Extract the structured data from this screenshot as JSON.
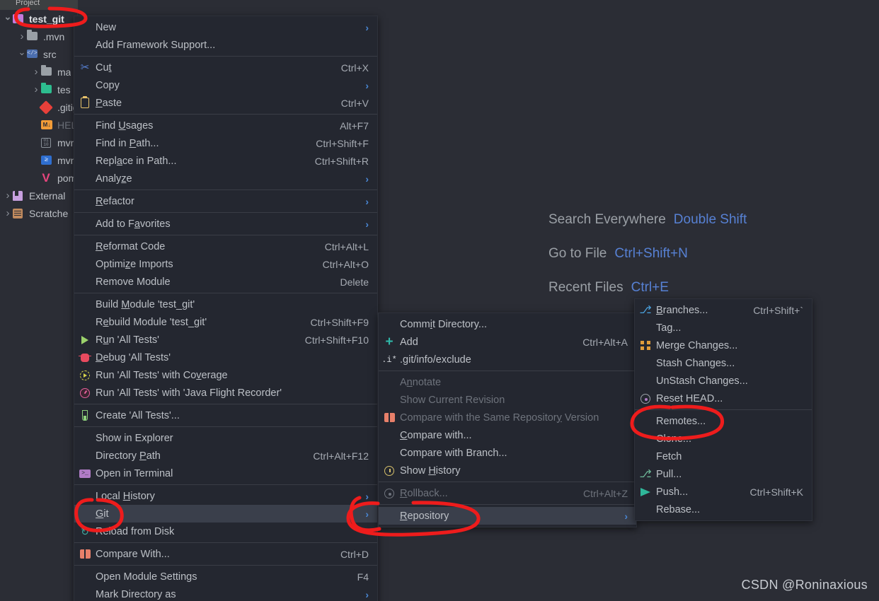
{
  "app": {
    "panel_title": "Project",
    "watermark": "CSDN @Roninaxious",
    "accent_blue": "#5781d4",
    "menu_bg": "#242730",
    "editor_bg": "#2b2d35",
    "annotation_color": "#ee1c1c"
  },
  "sidebar": {
    "items": [
      {
        "label": "test_git",
        "icon": "module-icon",
        "arrow": "down",
        "indent": 0,
        "dim": false,
        "root": true
      },
      {
        "label": ".mvn",
        "icon": "folder-icon",
        "arrow": "right",
        "indent": 1,
        "dim": false,
        "root": false
      },
      {
        "label": "src",
        "icon": "source-folder-icon",
        "arrow": "down",
        "indent": 1,
        "dim": false,
        "root": false
      },
      {
        "label": "ma",
        "icon": "folder-icon",
        "arrow": "right",
        "indent": 2,
        "dim": false,
        "root": false
      },
      {
        "label": "tes",
        "icon": "test-folder-icon",
        "arrow": "right",
        "indent": 2,
        "dim": false,
        "root": false
      },
      {
        "label": ".gitigr",
        "icon": "git-file-icon",
        "arrow": "blank",
        "indent": 2,
        "dim": false,
        "root": false
      },
      {
        "label": "HELP.",
        "icon": "markdown-icon",
        "arrow": "blank",
        "indent": 2,
        "dim": true,
        "root": false
      },
      {
        "label": "mvnw",
        "icon": "binary-file-icon",
        "arrow": "blank",
        "indent": 2,
        "dim": false,
        "root": false
      },
      {
        "label": "mvnw",
        "icon": "powershell-icon",
        "arrow": "blank",
        "indent": 2,
        "dim": false,
        "root": false
      },
      {
        "label": "pom.x",
        "icon": "maven-icon",
        "arrow": "blank",
        "indent": 2,
        "dim": false,
        "root": false
      },
      {
        "label": "External",
        "icon": "external-libs-icon",
        "arrow": "right",
        "indent": 0,
        "dim": false,
        "root": false
      },
      {
        "label": "Scratche",
        "icon": "scratches-icon",
        "arrow": "right",
        "indent": 0,
        "dim": false,
        "root": false
      }
    ]
  },
  "editor_hints": [
    {
      "label": "Search Everywhere",
      "key": "Double Shift"
    },
    {
      "label": "Go to File",
      "key": "Ctrl+Shift+N"
    },
    {
      "label": "Recent Files",
      "key": "Ctrl+E"
    }
  ],
  "context_menu": {
    "groups": [
      [
        {
          "label": "New",
          "accel": "",
          "icon": "",
          "shortcut": "",
          "submenu": true,
          "selected": false,
          "disabled": false
        },
        {
          "label": "Add Framework Support...",
          "accel": "",
          "icon": "",
          "shortcut": "",
          "submenu": false,
          "selected": false,
          "disabled": false
        }
      ],
      [
        {
          "label": "Cut",
          "accel": "t",
          "icon": "cut-icon",
          "shortcut": "Ctrl+X",
          "submenu": false,
          "selected": false,
          "disabled": false
        },
        {
          "label": "Copy",
          "accel": "",
          "icon": "",
          "shortcut": "",
          "submenu": true,
          "selected": false,
          "disabled": false
        },
        {
          "label": "Paste",
          "accel": "P",
          "icon": "paste-icon",
          "shortcut": "Ctrl+V",
          "submenu": false,
          "selected": false,
          "disabled": false
        }
      ],
      [
        {
          "label": "Find Usages",
          "accel": "U",
          "icon": "",
          "shortcut": "Alt+F7",
          "submenu": false,
          "selected": false,
          "disabled": false
        },
        {
          "label": "Find in Path...",
          "accel": "P",
          "icon": "",
          "shortcut": "Ctrl+Shift+F",
          "submenu": false,
          "selected": false,
          "disabled": false
        },
        {
          "label": "Replace in Path...",
          "accel": "a",
          "icon": "",
          "shortcut": "Ctrl+Shift+R",
          "submenu": false,
          "selected": false,
          "disabled": false
        },
        {
          "label": "Analyze",
          "accel": "z",
          "icon": "",
          "shortcut": "",
          "submenu": true,
          "selected": false,
          "disabled": false
        }
      ],
      [
        {
          "label": "Refactor",
          "accel": "R",
          "icon": "",
          "shortcut": "",
          "submenu": true,
          "selected": false,
          "disabled": false
        }
      ],
      [
        {
          "label": "Add to Favorites",
          "accel": "a",
          "icon": "",
          "shortcut": "",
          "submenu": true,
          "selected": false,
          "disabled": false
        }
      ],
      [
        {
          "label": "Reformat Code",
          "accel": "R",
          "icon": "",
          "shortcut": "Ctrl+Alt+L",
          "submenu": false,
          "selected": false,
          "disabled": false
        },
        {
          "label": "Optimize Imports",
          "accel": "z",
          "icon": "",
          "shortcut": "Ctrl+Alt+O",
          "submenu": false,
          "selected": false,
          "disabled": false
        },
        {
          "label": "Remove Module",
          "accel": "",
          "icon": "",
          "shortcut": "Delete",
          "submenu": false,
          "selected": false,
          "disabled": false
        }
      ],
      [
        {
          "label": "Build Module 'test_git'",
          "accel": "M",
          "icon": "",
          "shortcut": "",
          "submenu": false,
          "selected": false,
          "disabled": false
        },
        {
          "label": "Rebuild Module 'test_git'",
          "accel": "e",
          "icon": "",
          "shortcut": "Ctrl+Shift+F9",
          "submenu": false,
          "selected": false,
          "disabled": false
        },
        {
          "label": "Run 'All Tests'",
          "accel": "u",
          "icon": "run-icon",
          "shortcut": "Ctrl+Shift+F10",
          "submenu": false,
          "selected": false,
          "disabled": false
        },
        {
          "label": "Debug 'All Tests'",
          "accel": "D",
          "icon": "debug-icon",
          "shortcut": "",
          "submenu": false,
          "selected": false,
          "disabled": false
        },
        {
          "label": "Run 'All Tests' with Coverage",
          "accel": "v",
          "icon": "coverage-icon",
          "shortcut": "",
          "submenu": false,
          "selected": false,
          "disabled": false
        },
        {
          "label": "Run 'All Tests' with 'Java Flight Recorder'",
          "accel": "",
          "icon": "jfr-icon",
          "shortcut": "",
          "submenu": false,
          "selected": false,
          "disabled": false
        }
      ],
      [
        {
          "label": "Create 'All Tests'...",
          "accel": "",
          "icon": "test-tube-icon",
          "shortcut": "",
          "submenu": false,
          "selected": false,
          "disabled": false
        }
      ],
      [
        {
          "label": "Show in Explorer",
          "accel": "",
          "icon": "",
          "shortcut": "",
          "submenu": false,
          "selected": false,
          "disabled": false
        },
        {
          "label": "Directory Path",
          "accel": "P",
          "icon": "",
          "shortcut": "Ctrl+Alt+F12",
          "submenu": false,
          "selected": false,
          "disabled": false
        },
        {
          "label": "Open in Terminal",
          "accel": "",
          "icon": "terminal-icon",
          "shortcut": "",
          "submenu": false,
          "selected": false,
          "disabled": false
        }
      ],
      [
        {
          "label": "Local History",
          "accel": "H",
          "icon": "",
          "shortcut": "",
          "submenu": true,
          "selected": false,
          "disabled": false
        },
        {
          "label": "Git",
          "accel": "G",
          "icon": "",
          "shortcut": "",
          "submenu": true,
          "selected": true,
          "disabled": false
        },
        {
          "label": "Reload from Disk",
          "accel": "",
          "icon": "reload-icon",
          "shortcut": "",
          "submenu": false,
          "selected": false,
          "disabled": false
        }
      ],
      [
        {
          "label": "Compare With...",
          "accel": "",
          "icon": "compare-icon",
          "shortcut": "Ctrl+D",
          "submenu": false,
          "selected": false,
          "disabled": false
        }
      ],
      [
        {
          "label": "Open Module Settings",
          "accel": "",
          "icon": "",
          "shortcut": "F4",
          "submenu": false,
          "selected": false,
          "disabled": false
        },
        {
          "label": "Mark Directory as",
          "accel": "",
          "icon": "",
          "shortcut": "",
          "submenu": true,
          "selected": false,
          "disabled": false
        }
      ]
    ]
  },
  "git_submenu": {
    "groups": [
      [
        {
          "label": "Commit Directory...",
          "accel": "i",
          "icon": "",
          "shortcut": "",
          "submenu": false,
          "selected": false,
          "disabled": false
        },
        {
          "label": "Add",
          "accel": "",
          "icon": "add-icon",
          "shortcut": "Ctrl+Alt+A",
          "submenu": false,
          "selected": false,
          "disabled": false
        },
        {
          "label": ".git/info/exclude",
          "accel": "",
          "icon": "exclude-icon",
          "shortcut": "",
          "submenu": false,
          "selected": false,
          "disabled": false
        }
      ],
      [
        {
          "label": "Annotate",
          "accel": "n",
          "icon": "",
          "shortcut": "",
          "submenu": false,
          "selected": false,
          "disabled": true
        },
        {
          "label": "Show Current Revision",
          "accel": "",
          "icon": "",
          "shortcut": "",
          "submenu": false,
          "selected": false,
          "disabled": true
        },
        {
          "label": "Compare with the Same Repository Version",
          "accel": "y",
          "icon": "compare-icon",
          "shortcut": "",
          "submenu": false,
          "selected": false,
          "disabled": true
        },
        {
          "label": "Compare with...",
          "accel": "C",
          "icon": "",
          "shortcut": "",
          "submenu": false,
          "selected": false,
          "disabled": false
        },
        {
          "label": "Compare with Branch...",
          "accel": "",
          "icon": "",
          "shortcut": "",
          "submenu": false,
          "selected": false,
          "disabled": false
        },
        {
          "label": "Show History",
          "accel": "H",
          "icon": "history-icon",
          "shortcut": "",
          "submenu": false,
          "selected": false,
          "disabled": false
        }
      ],
      [
        {
          "label": "Rollback...",
          "accel": "R",
          "icon": "rollback-icon",
          "shortcut": "Ctrl+Alt+Z",
          "submenu": false,
          "selected": false,
          "disabled": true
        }
      ],
      [
        {
          "label": "Repository",
          "accel": "R",
          "icon": "",
          "shortcut": "",
          "submenu": true,
          "selected": true,
          "disabled": false
        }
      ]
    ]
  },
  "repository_submenu": {
    "groups": [
      [
        {
          "label": "Branches...",
          "accel": "B",
          "icon": "branch-icon",
          "shortcut": "Ctrl+Shift+`",
          "submenu": false,
          "selected": false,
          "disabled": false
        },
        {
          "label": "Tag...",
          "accel": "",
          "icon": "",
          "shortcut": "",
          "submenu": false,
          "selected": false,
          "disabled": false
        },
        {
          "label": "Merge Changes...",
          "accel": "",
          "icon": "merge-icon",
          "shortcut": "",
          "submenu": false,
          "selected": false,
          "disabled": false
        },
        {
          "label": "Stash Changes...",
          "accel": "",
          "icon": "",
          "shortcut": "",
          "submenu": false,
          "selected": false,
          "disabled": false
        },
        {
          "label": "UnStash Changes...",
          "accel": "",
          "icon": "",
          "shortcut": "",
          "submenu": false,
          "selected": false,
          "disabled": false
        },
        {
          "label": "Reset HEAD...",
          "accel": "",
          "icon": "reset-icon",
          "shortcut": "",
          "submenu": false,
          "selected": false,
          "disabled": false
        }
      ],
      [
        {
          "label": "Remotes...",
          "accel": "",
          "icon": "",
          "shortcut": "",
          "submenu": false,
          "selected": false,
          "disabled": false
        },
        {
          "label": "Clone...",
          "accel": "",
          "icon": "",
          "shortcut": "",
          "submenu": false,
          "selected": false,
          "disabled": false
        },
        {
          "label": "Fetch",
          "accel": "",
          "icon": "",
          "shortcut": "",
          "submenu": false,
          "selected": false,
          "disabled": false
        },
        {
          "label": "Pull...",
          "accel": "",
          "icon": "pull-icon",
          "shortcut": "",
          "submenu": false,
          "selected": false,
          "disabled": false
        },
        {
          "label": "Push...",
          "accel": "",
          "icon": "push-icon",
          "shortcut": "Ctrl+Shift+K",
          "submenu": false,
          "selected": false,
          "disabled": false
        },
        {
          "label": "Rebase...",
          "accel": "",
          "icon": "",
          "shortcut": "",
          "submenu": false,
          "selected": false,
          "disabled": false
        }
      ]
    ]
  },
  "annotations": [
    {
      "name": "test-git-circle",
      "target": "test_git"
    },
    {
      "name": "git-circle",
      "target": "Git"
    },
    {
      "name": "git-arrow-circle",
      "target": "Git submenu arrow"
    },
    {
      "name": "repository-circle",
      "target": "Repository"
    },
    {
      "name": "remotes-circle",
      "target": "Remotes..."
    }
  ]
}
